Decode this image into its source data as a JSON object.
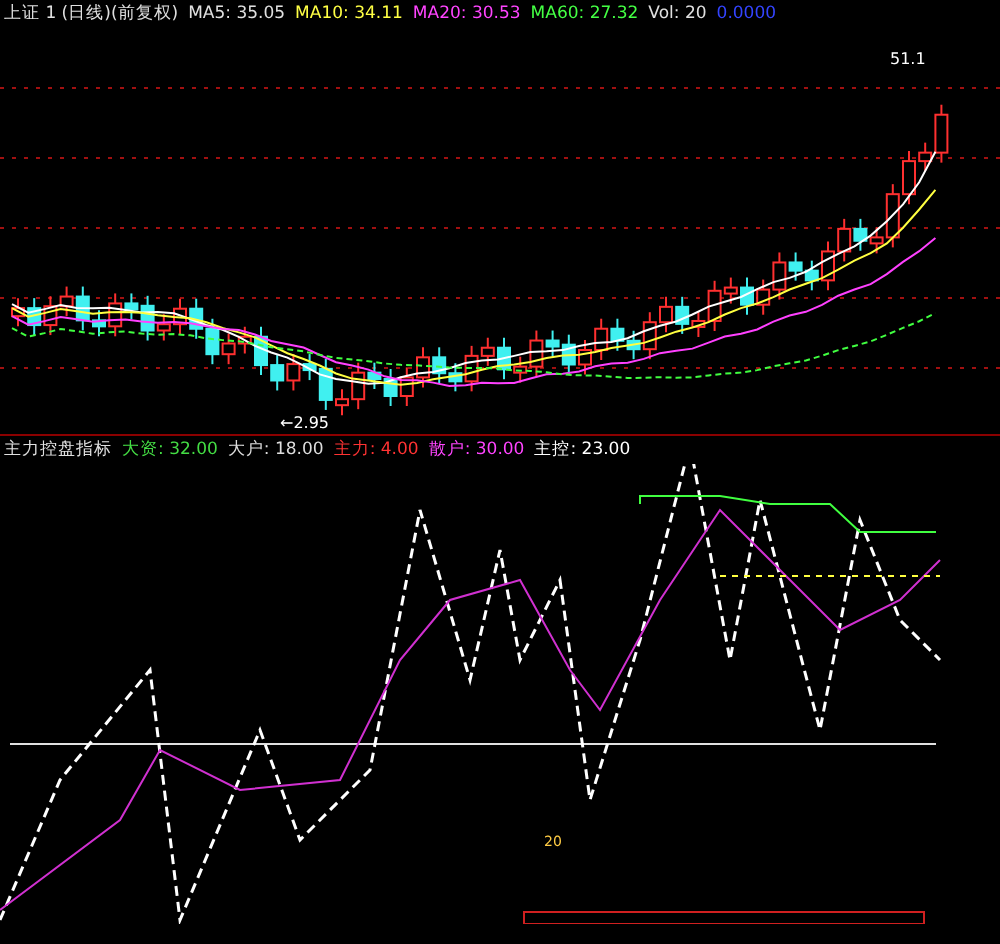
{
  "main_chart": {
    "header": [
      {
        "text": "上证 1 (日线)(前复权)",
        "color": "#e0e0e0"
      },
      {
        "text": "MA5: 35.05",
        "color": "#e0e0e0"
      },
      {
        "text": "MA10: 34.11",
        "color": "#ffff44"
      },
      {
        "text": "MA20: 30.53",
        "color": "#ff44ff"
      },
      {
        "text": "MA60: 27.32",
        "color": "#44ff44"
      },
      {
        "text": "Vol: 20",
        "color": "#e0e0e0"
      },
      {
        "text": "0.0000",
        "color": "#3344ff"
      }
    ],
    "low_label": "←2.95",
    "high_label": "51.1"
  },
  "indicator": {
    "header": [
      {
        "text": "主力控盘指标",
        "color": "#e0e0e0"
      },
      {
        "text": "大资: 32.00",
        "color": "#44dd44"
      },
      {
        "text": "大户: 18.00",
        "color": "#dddddd"
      },
      {
        "text": "主力: 4.00",
        "color": "#ff3333"
      },
      {
        "text": "散户: 30.00",
        "color": "#ff44ff"
      },
      {
        "text": "主控: 23.00",
        "color": "#ffffff"
      }
    ],
    "marker_label": "20"
  }
}
